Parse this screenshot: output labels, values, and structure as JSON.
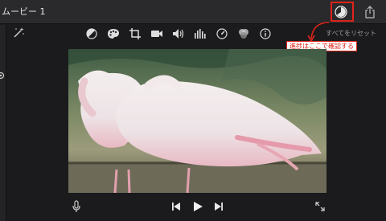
{
  "window": {
    "title": "ムービー 1"
  },
  "header": {
    "progress_icon": "progress-pie-icon",
    "share_icon": "share-icon"
  },
  "viewer_toolbar": {
    "tools": [
      {
        "name": "color-balance",
        "icon": "color-balance-icon"
      },
      {
        "name": "color-correction",
        "icon": "palette-icon"
      },
      {
        "name": "crop",
        "icon": "crop-icon"
      },
      {
        "name": "stabilization",
        "icon": "video-camera-icon"
      },
      {
        "name": "volume",
        "icon": "speaker-icon"
      },
      {
        "name": "noise-reduction-equalizer",
        "icon": "equalizer-icon"
      },
      {
        "name": "speed",
        "icon": "speedometer-icon"
      },
      {
        "name": "clip-filter",
        "icon": "filter-circles-icon"
      },
      {
        "name": "clip-info",
        "icon": "info-icon"
      }
    ],
    "reset_all_label": "すべてをリセット"
  },
  "annotation": {
    "callout_text": "進捗はここで確認する",
    "color": "#e0231a"
  },
  "video": {
    "subject": "pink-flamingos"
  },
  "playback": {
    "voiceover_icon": "microphone-icon",
    "prev_icon": "skip-back-icon",
    "play_icon": "play-icon",
    "next_icon": "skip-forward-icon",
    "fullscreen_icon": "fullscreen-icon"
  },
  "colors": {
    "accent": "#e0231a",
    "chrome": "#2a2a2c",
    "background": "#1b1b1d"
  }
}
